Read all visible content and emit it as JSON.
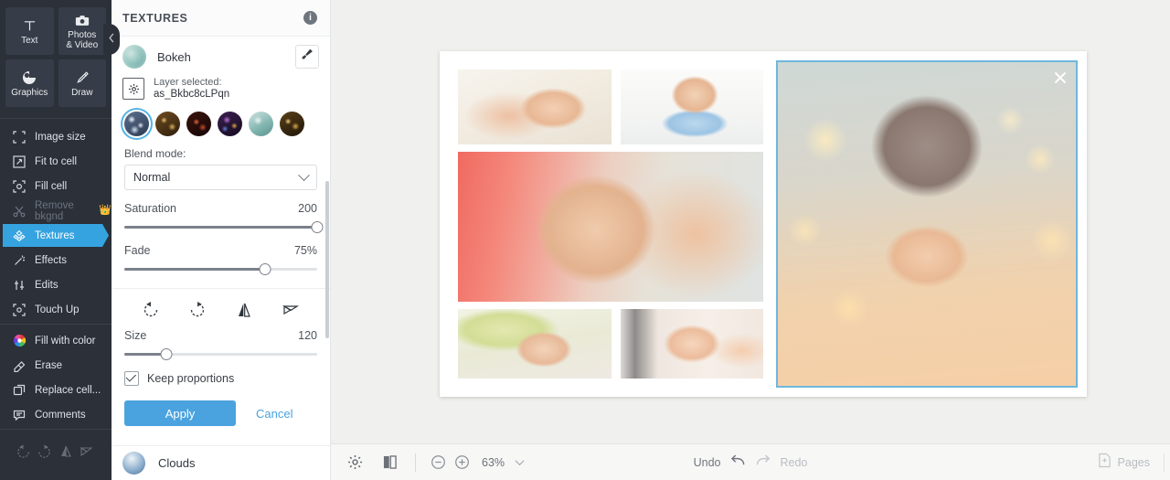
{
  "rail": {
    "tiles": [
      {
        "label": "Text",
        "icon": "text-icon"
      },
      {
        "label": "Photos\n& Video",
        "icon": "camera-icon"
      },
      {
        "label": "Graphics",
        "icon": "graphics-icon"
      },
      {
        "label": "Draw",
        "icon": "draw-pencil-icon"
      }
    ],
    "tile_labels": {
      "text": "Text",
      "photos_line1": "Photos",
      "photos_line2": "& Video",
      "graphics": "Graphics",
      "draw": "Draw"
    },
    "items": [
      {
        "label": "Image size",
        "icon": "image-size-icon",
        "state": "normal"
      },
      {
        "label": "Fit to cell",
        "icon": "fit-to-cell-icon",
        "state": "normal"
      },
      {
        "label": "Fill cell",
        "icon": "fill-cell-icon",
        "state": "normal"
      },
      {
        "label": "Remove bkgnd",
        "icon": "scissors-icon",
        "state": "disabled",
        "badge": "crown"
      },
      {
        "label": "Textures",
        "icon": "textures-icon",
        "state": "active"
      },
      {
        "label": "Effects",
        "icon": "effects-wand-icon",
        "state": "normal"
      },
      {
        "label": "Edits",
        "icon": "edits-sliders-icon",
        "state": "normal"
      },
      {
        "label": "Touch Up",
        "icon": "touch-up-icon",
        "state": "normal"
      },
      {
        "label": "Fill with color",
        "icon": "color-wheel-icon",
        "state": "normal"
      },
      {
        "label": "Erase",
        "icon": "eraser-icon",
        "state": "normal"
      },
      {
        "label": "Replace cell...",
        "icon": "replace-cell-icon",
        "state": "normal"
      },
      {
        "label": "Comments",
        "icon": "comments-icon",
        "state": "normal"
      }
    ],
    "history": [
      {
        "icon": "undo-icon"
      },
      {
        "icon": "redo-icon"
      },
      {
        "icon": "flip-vertical-icon"
      },
      {
        "icon": "flip-horizontal-icon"
      }
    ],
    "collapse_icon": "chevron-left-icon"
  },
  "panel": {
    "title": "TEXTURES",
    "info_icon_label": "i",
    "texture_name": "Bokeh",
    "brush_icon": "brush-icon",
    "layer_caption": "Layer selected:",
    "layer_id": "as_Bkbc8cLPqn",
    "swatches": [
      {
        "name": "bokeh-blue-swatch",
        "selected": true
      },
      {
        "name": "bokeh-gold-swatch",
        "selected": false
      },
      {
        "name": "bokeh-red-swatch",
        "selected": false
      },
      {
        "name": "bokeh-violet-swatch",
        "selected": false
      },
      {
        "name": "bokeh-teal-swatch",
        "selected": false
      },
      {
        "name": "bokeh-amber-swatch",
        "selected": false
      }
    ],
    "blend_mode_label": "Blend mode:",
    "blend_mode_value": "Normal",
    "saturation_label": "Saturation",
    "saturation_value": "200",
    "saturation_percent": 100,
    "fade_label": "Fade",
    "fade_value": "75%",
    "fade_percent": 73,
    "transform_buttons": [
      {
        "name": "rotate-left-icon"
      },
      {
        "name": "rotate-right-icon"
      },
      {
        "name": "flip-horizontal-icon"
      },
      {
        "name": "flip-vertical-icon"
      }
    ],
    "size_label": "Size",
    "size_value": "120",
    "size_percent": 22,
    "keep_proportions_label": "Keep proportions",
    "keep_proportions_checked": true,
    "apply_label": "Apply",
    "cancel_label": "Cancel",
    "footer_texture_name": "Clouds"
  },
  "canvas": {
    "cells": [
      {
        "name": "collage-cell-baby-on-white",
        "cls": "p1"
      },
      {
        "name": "collage-cell-baby-blue-onesie",
        "cls": "p2"
      },
      {
        "name": "collage-cell-baby-pink-blanket",
        "cls": "p3"
      },
      {
        "name": "collage-cell-baby-green-towel",
        "cls": "p4"
      },
      {
        "name": "collage-cell-baby-tongue-out",
        "cls": "p5"
      }
    ],
    "selected_cell": {
      "name": "collage-cell-baby-knit-hat-selected",
      "cls": "p6",
      "close_icon": "close-icon"
    }
  },
  "bottombar": {
    "settings_icon": "gear-icon",
    "compare_icon": "compare-panels-icon",
    "zoom_out_icon": "zoom-out-icon",
    "zoom_in_icon": "zoom-in-icon",
    "zoom_value": "63%",
    "zoom_chevron_icon": "chevron-down-icon",
    "undo_label": "Undo",
    "undo_icon": "undo-arrow-icon",
    "redo_icon": "redo-arrow-icon",
    "redo_label": "Redo",
    "pages_icon": "add-page-icon",
    "pages_label": "Pages"
  },
  "colors": {
    "rail_bg": "#2b3039",
    "accent_blue": "#35a3e0",
    "apply_blue": "#4aa3df",
    "stage_bg": "#f0f0ee",
    "selection_border": "#6fb7de",
    "crown_gold": "#f5b50a"
  }
}
